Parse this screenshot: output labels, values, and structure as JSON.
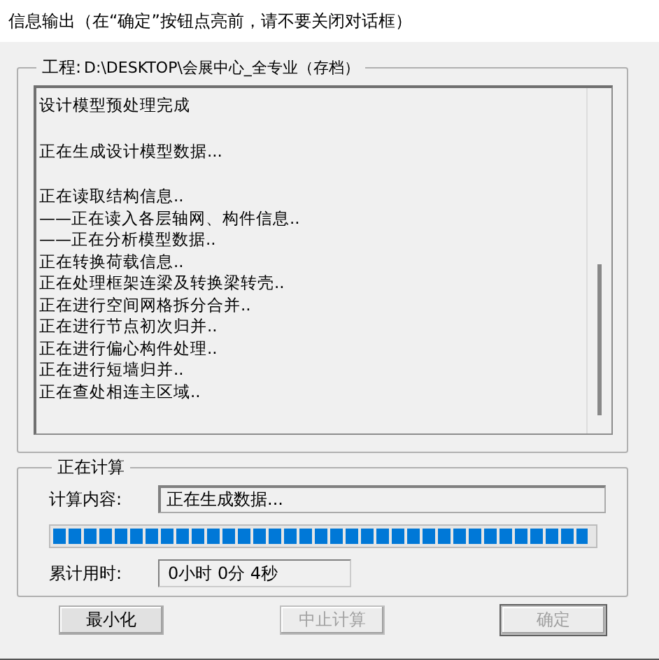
{
  "window": {
    "title": "信息输出（在“确定”按钮点亮前，请不要关闭对话框）"
  },
  "project_group": {
    "label": "工程:",
    "path": "D:\\DESKTOP\\会展中心_全专业（存档）",
    "log_blocks": [
      [
        "设计模型预处理完成"
      ],
      [
        "正在生成设计模型数据..."
      ],
      [
        "正在读取结构信息..",
        "——正在读入各层轴网、构件信息..",
        "——正在分析模型数据..",
        "正在转换荷载信息..",
        "正在处理框架连梁及转换梁转壳..",
        "正在进行空间网格拆分合并..",
        "正在进行节点初次归并..",
        "正在进行偏心构件处理..",
        "正在进行短墙归并..",
        "正在查处相连主区域.."
      ]
    ]
  },
  "calc_group": {
    "title": "正在计算",
    "content_label": "计算内容:",
    "content_value": "正在生成数据...",
    "progress": {
      "level": 0.99
    },
    "elapsed_label": "累计用时:",
    "elapsed_value": "0小时 0分 4秒"
  },
  "buttons": [
    {
      "label": "最小化",
      "disabled": false,
      "default": false
    },
    {
      "label": "中止计算",
      "disabled": true,
      "default": false
    },
    {
      "label": "确定",
      "disabled": true,
      "default": true
    }
  ]
}
